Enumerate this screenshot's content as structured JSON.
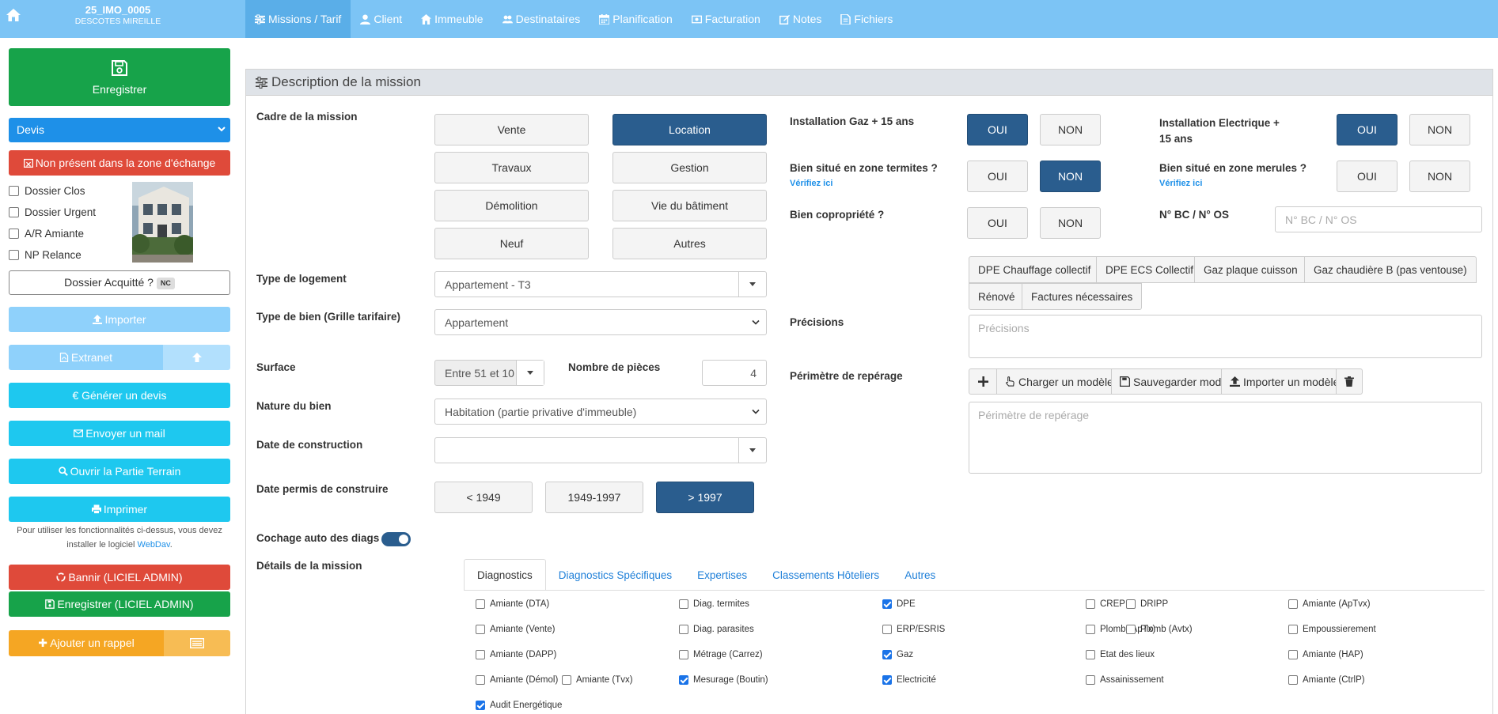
{
  "topbar": {
    "dossier_ref": "25_IMO_0005",
    "client_name": "DESCOTES MIREILLE",
    "nav": [
      {
        "label": "Missions / Tarif",
        "icon": "sliders-icon",
        "active": true
      },
      {
        "label": "Client",
        "icon": "user-icon"
      },
      {
        "label": "Immeuble",
        "icon": "home-icon"
      },
      {
        "label": "Destinataires",
        "icon": "users-icon"
      },
      {
        "label": "Planification",
        "icon": "calendar-icon"
      },
      {
        "label": "Facturation",
        "icon": "money-icon"
      },
      {
        "label": "Notes",
        "icon": "edit-icon"
      },
      {
        "label": "Fichiers",
        "icon": "file-icon"
      }
    ]
  },
  "sidebar": {
    "save_label": "Enregistrer",
    "status_select": "Devis",
    "absent_label": "Non présent dans la zone d'échange",
    "checks": [
      {
        "label": "Dossier Clos",
        "checked": false
      },
      {
        "label": "Dossier Urgent",
        "checked": false
      },
      {
        "label": "A/R Amiante",
        "checked": false
      },
      {
        "label": "NP Relance",
        "checked": false
      }
    ],
    "acquitte_label": "Dossier Acquitté ?",
    "acquitte_badge": "NC",
    "import_label": "Importer",
    "extranet_label": "Extranet",
    "devis_label": "Générer un devis",
    "mail_label": "Envoyer un mail",
    "terrain_label": "Ouvrir la Partie Terrain",
    "print_label": "Imprimer",
    "webdav_note": "Pour utiliser les fonctionnalités ci-dessus, vous devez installer le logiciel",
    "webdav_link": "WebDav",
    "bannir_label": "Bannir (LICIEL ADMIN)",
    "save_admin_label": "Enregistrer (LICIEL ADMIN)",
    "rappel_label": "Ajouter un rappel",
    "colors": {
      "green": "#17a34a",
      "red": "#df4a3a",
      "cyan": "#1ec8ef",
      "orange": "#f5a623",
      "blue": "#1e90e8"
    }
  },
  "panel": {
    "title": "Description de la mission",
    "cadre_label": "Cadre de la mission",
    "cadre_options": [
      {
        "label": "Vente",
        "selected": false
      },
      {
        "label": "Location",
        "selected": true
      },
      {
        "label": "Travaux",
        "selected": false
      },
      {
        "label": "Gestion",
        "selected": false
      },
      {
        "label": "Démolition",
        "selected": false
      },
      {
        "label": "Vie du bâtiment",
        "selected": false
      },
      {
        "label": "Neuf",
        "selected": false
      },
      {
        "label": "Autres",
        "selected": false
      }
    ],
    "type_logement_label": "Type de logement",
    "type_logement_value": "Appartement - T3",
    "type_bien_label": "Type de bien (Grille tarifaire)",
    "type_bien_value": "Appartement",
    "surface_label": "Surface",
    "surface_value": "Entre 51 et 10",
    "pieces_label": "Nombre de pièces",
    "pieces_value": "4",
    "nature_label": "Nature du bien",
    "nature_value": "Habitation (partie privative d'immeuble)",
    "date_construction_label": "Date de construction",
    "date_construction_value": "",
    "date_permis_label": "Date permis de construire",
    "date_permis_options": [
      {
        "label": "< 1949",
        "selected": false
      },
      {
        "label": "1949-1997",
        "selected": false
      },
      {
        "label": "> 1997",
        "selected": true
      }
    ],
    "cochage_label": "Cochage auto des diags",
    "details_label": "Détails de la mission",
    "gaz_label": "Installation Gaz + 15 ans",
    "elec_label": "Installation Electrique + 15 ans",
    "termites_label": "Bien situé en zone termites ?",
    "merules_label": "Bien situé en zone merules ?",
    "verify_link": "Vérifiez ici",
    "copro_label": "Bien copropriété ?",
    "bc_label": "N° BC / N° OS",
    "bc_placeholder": "N° BC / N° OS",
    "oui": "OUI",
    "non": "NON",
    "tags": [
      "DPE Chauffage collectif",
      "DPE ECS Collectif",
      "Gaz plaque cuisson",
      "Gaz chaudière B (pas ventouse)",
      "Rénové",
      "Factures nécessaires"
    ],
    "precisions_label": "Précisions",
    "precisions_placeholder": "Précisions",
    "perimetre_label": "Périmètre de repérage",
    "perimetre_placeholder": "Périmètre de repérage",
    "charger_label": "Charger un modèle",
    "sauvegarder_label": "Sauvegarder modèle",
    "importer_modele_label": "Importer un modèle"
  },
  "tabs": [
    "Diagnostics",
    "Diagnostics Spécifiques",
    "Expertises",
    "Classements Hôteliers",
    "Autres"
  ],
  "diags": {
    "c1": [
      {
        "label": "Amiante (DTA)",
        "checked": false
      },
      {
        "label": "Amiante (Vente)",
        "checked": false
      },
      {
        "label": "Amiante (DAPP)",
        "checked": false
      },
      {
        "label": "Amiante (Démol)",
        "checked": false
      },
      {
        "label": "Audit Energétique",
        "checked": true
      }
    ],
    "tvx": {
      "label": "Amiante (Tvx)",
      "checked": false
    },
    "c2": [
      {
        "label": "Diag. termites",
        "checked": false
      },
      {
        "label": "Diag. parasites",
        "checked": false
      },
      {
        "label": "Métrage (Carrez)",
        "checked": false
      },
      {
        "label": "Mesurage (Boutin)",
        "checked": true
      }
    ],
    "c3": [
      {
        "label": "DPE",
        "checked": true
      },
      {
        "label": "ERP/ESRIS",
        "checked": false
      },
      {
        "label": "Gaz",
        "checked": true
      },
      {
        "label": "Electricité",
        "checked": true
      }
    ],
    "c4": [
      {
        "label": "CREP",
        "checked": false
      },
      {
        "label": "Plomb (ApTx)",
        "checked": false
      },
      {
        "label": "Etat des lieux",
        "checked": false
      },
      {
        "label": "Assainissement",
        "checked": false
      }
    ],
    "c4b": [
      {
        "label": "DRIPP",
        "checked": false
      },
      {
        "label": "Plomb (Avtx)",
        "checked": false
      }
    ],
    "c5": [
      {
        "label": "Amiante (ApTvx)",
        "checked": false
      },
      {
        "label": "Empoussierement",
        "checked": false
      },
      {
        "label": "Amiante (HAP)",
        "checked": false
      },
      {
        "label": "Amiante (CtrlP)",
        "checked": false
      }
    ]
  }
}
